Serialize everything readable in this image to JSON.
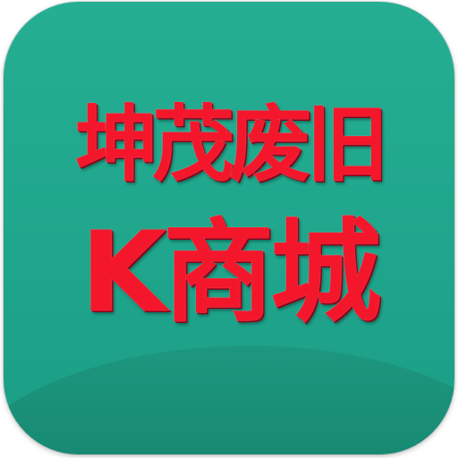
{
  "icon": {
    "line1": "坤茂废旧",
    "line2": "K商城"
  },
  "colors": {
    "background_top": "#25ae92",
    "background_bottom": "#1c9d86",
    "wave": "#1a8f78",
    "text": "#f4172b",
    "text_outline": "#a8001a"
  }
}
